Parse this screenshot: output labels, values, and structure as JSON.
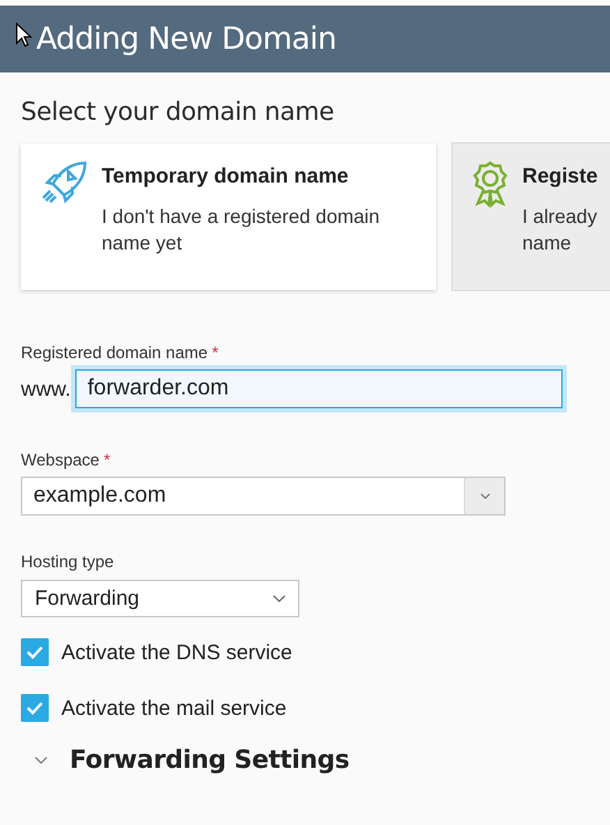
{
  "header": {
    "title": "Adding New Domain"
  },
  "section_title": "Select your domain name",
  "options": [
    {
      "kind": "rocket",
      "title": "Temporary domain name",
      "lines": [
        "I don't have a registered domain",
        "name yet"
      ],
      "selected": false
    },
    {
      "kind": "award",
      "title": "Registe",
      "lines": [
        "I already",
        "name"
      ],
      "selected": true
    }
  ],
  "domain_field": {
    "label": "Registered domain name",
    "required_mark": "*",
    "prefix": "www.",
    "value": "forwarder.com",
    "focused": true
  },
  "webspace": {
    "label": "Webspace",
    "required_mark": "*",
    "value": "example.com"
  },
  "hosting_type": {
    "label": "Hosting type",
    "value": "Forwarding"
  },
  "checkboxes": [
    {
      "label": "Activate the DNS service",
      "checked": true
    },
    {
      "label": "Activate the mail service",
      "checked": true
    }
  ],
  "forwarding_section": {
    "title": "Forwarding Settings",
    "expanded": false
  }
}
